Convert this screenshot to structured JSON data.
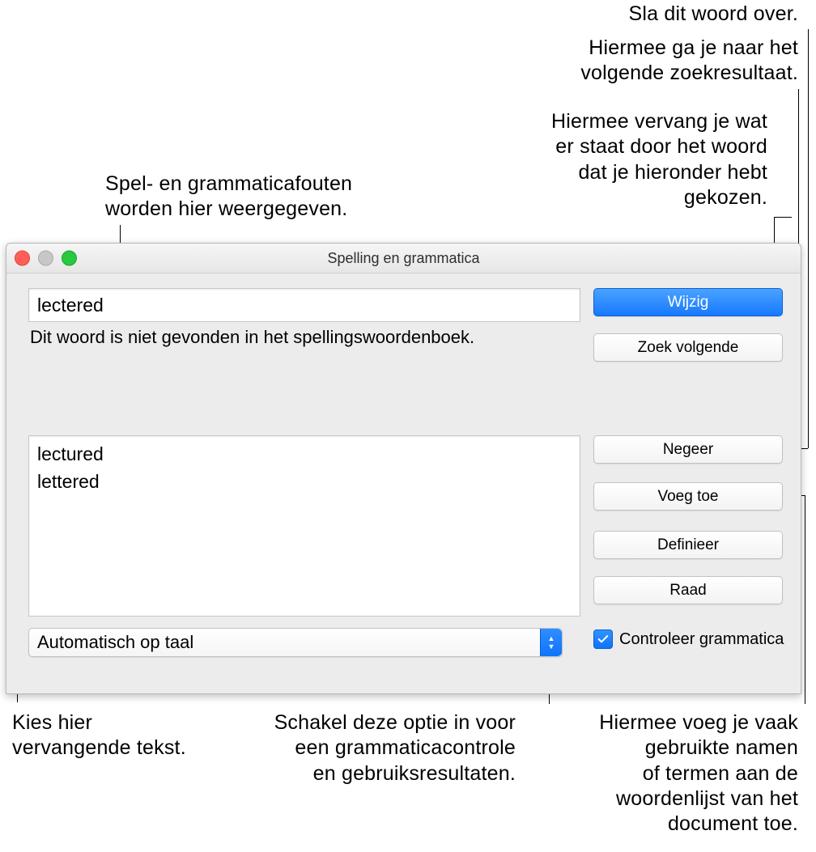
{
  "callouts": {
    "skip_word": "Sla dit woord over.",
    "go_next": "Hiermee ga je naar het\nvolgende zoekresultaat.",
    "replace_word": "Hiermee vervang je wat\ner staat door het woord\ndat je hieronder hebt\ngekozen.",
    "errors_shown": "Spel- en grammaticafouten\nworden hier weergegeven.",
    "choose_replacement": "Kies hier\nvervangende tekst.",
    "enable_grammar": "Schakel deze optie in voor\neen grammaticacontrole\nen gebruiksresultaten.",
    "add_common": "Hiermee voeg je vaak\ngebruikte namen\nof termen aan de\nwoordenlijst van het\ndocument toe."
  },
  "window": {
    "title": "Spelling en grammatica",
    "misspelled_word": "lectered",
    "not_found_msg": "Dit woord is niet gevonden in het spellingswoordenboek.",
    "buttons": {
      "change": "Wijzig",
      "find_next": "Zoek volgende",
      "ignore": "Negeer",
      "add": "Voeg toe",
      "define": "Definieer",
      "guess": "Raad"
    },
    "suggestions": [
      "lectured",
      "lettered"
    ],
    "language_popup": "Automatisch op taal",
    "grammar_checkbox_label": "Controleer grammatica"
  }
}
